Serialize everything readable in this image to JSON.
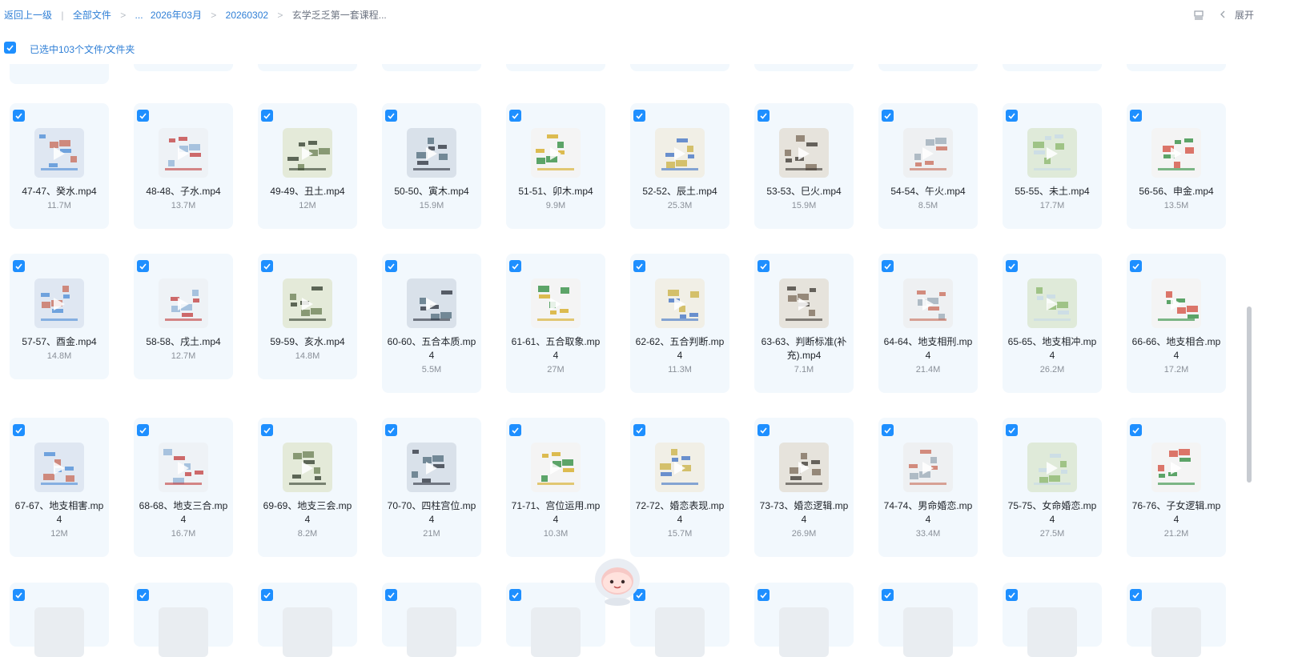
{
  "breadcrumb": {
    "back": "返回上一级",
    "root": "全部文件",
    "ellipsis": "...",
    "month": "2026年03月",
    "date": "20260302",
    "current": "玄学乏乏第一套课程..."
  },
  "toolbar": {
    "expand": "展开"
  },
  "selection": {
    "text": "已选中103个文件/文件夹"
  },
  "colors": {
    "accent": "#1e8fff",
    "link": "#2f7fd6",
    "card": "#f2f8fd"
  },
  "rows": [
    {
      "items": [
        {
          "name": "47-47、癸水.mp4",
          "size": "11.7M"
        },
        {
          "name": "48-48、子水.mp4",
          "size": "13.7M"
        },
        {
          "name": "49-49、丑土.mp4",
          "size": "12M"
        },
        {
          "name": "50-50、寅木.mp4",
          "size": "15.9M"
        },
        {
          "name": "51-51、卯木.mp4",
          "size": "9.9M"
        },
        {
          "name": "52-52、辰土.mp4",
          "size": "25.3M"
        },
        {
          "name": "53-53、巳火.mp4",
          "size": "15.9M"
        },
        {
          "name": "54-54、午火.mp4",
          "size": "8.5M"
        },
        {
          "name": "55-55、未土.mp4",
          "size": "17.7M"
        },
        {
          "name": "56-56、申金.mp4",
          "size": "13.5M"
        }
      ]
    },
    {
      "items": [
        {
          "name": "57-57、酉金.mp4",
          "size": "14.8M"
        },
        {
          "name": "58-58、戌土.mp4",
          "size": "12.7M"
        },
        {
          "name": "59-59、亥水.mp4",
          "size": "14.8M"
        },
        {
          "name": "60-60、五合本质.mp4",
          "size": "5.5M"
        },
        {
          "name": "61-61、五合取象.mp4",
          "size": "27M"
        },
        {
          "name": "62-62、五合判断.mp4",
          "size": "11.3M"
        },
        {
          "name": "63-63、判断标准(补充).mp4",
          "size": "7.1M"
        },
        {
          "name": "64-64、地支相刑.mp4",
          "size": "21.4M"
        },
        {
          "name": "65-65、地支相冲.mp4",
          "size": "26.2M"
        },
        {
          "name": "66-66、地支相合.mp4",
          "size": "17.2M"
        }
      ]
    },
    {
      "items": [
        {
          "name": "67-67、地支相害.mp4",
          "size": "12M"
        },
        {
          "name": "68-68、地支三合.mp4",
          "size": "16.7M"
        },
        {
          "name": "69-69、地支三会.mp4",
          "size": "8.2M"
        },
        {
          "name": "70-70、四柱宫位.mp4",
          "size": "21M"
        },
        {
          "name": "71-71、宫位运用.mp4",
          "size": "10.3M"
        },
        {
          "name": "72-72、婚恋表现.mp4",
          "size": "15.7M"
        },
        {
          "name": "73-73、婚恋逻辑.mp4",
          "size": "26.9M"
        },
        {
          "name": "74-74、男命婚恋.mp4",
          "size": "33.4M"
        },
        {
          "name": "75-75、女命婚恋.mp4",
          "size": "27.5M"
        },
        {
          "name": "76-76、子女逻辑.mp4",
          "size": "21.2M"
        }
      ]
    }
  ]
}
